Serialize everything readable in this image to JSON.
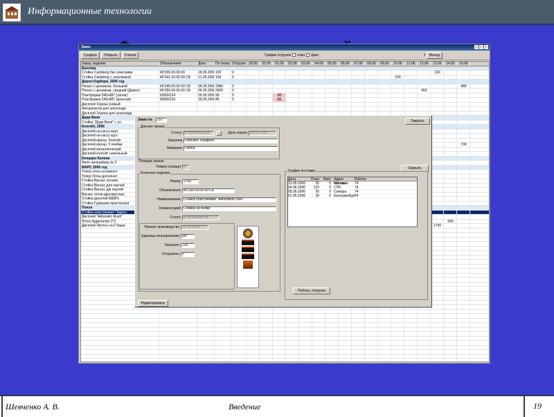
{
  "header": {
    "title": "Информационные технологии"
  },
  "slide": {
    "title": "Формирование производственной программы"
  },
  "footer": {
    "author": "Шевченко А. В.",
    "section": "Введение",
    "page": "19"
  },
  "app": {
    "window_title": "Заказ",
    "toolbar": {
      "create": "Создать",
      "open": "Открыть",
      "list": "Список",
      "chart_label": "График отгрузок",
      "plan_label": "план",
      "fact_label": "факт",
      "info": "i",
      "exit": "Выход"
    },
    "columns": [
      "Заказ, изделие",
      "Обозначение",
      "Дата",
      "По плану",
      "Отгрузка",
      "30.05",
      "31.05",
      "01.06",
      "02.06",
      "03.06",
      "04.06",
      "05.06",
      "06.06",
      "07.06",
      "08.06",
      "09.06",
      "10.06",
      "11.06",
      "12.06",
      "13.06",
      "14.06",
      "15.06"
    ],
    "rows": [
      {
        "g": true,
        "n": "Балтика"
      },
      {
        "n": "Стойка Carlsberg без электрики",
        "o": "КР.339.00.00.00",
        "d": "18.05.2006",
        "p": "100",
        "s": "0",
        "m": [
          14,
          "100"
        ]
      },
      {
        "n": "Стойка Carlsberg с электрикой",
        "o": "КР.341.00.00.00 СБ",
        "d": "21.05.2006",
        "p": "100",
        "s": "0",
        "m": [
          11,
          "100"
        ]
      },
      {
        "g": true,
        "n": "Дирол Кэдбери, 2006 год"
      },
      {
        "n": "Пенал с ценником, большой",
        "o": "КР.349.00.00.00 СБ",
        "d": "06.05.2006",
        "p": "2980",
        "s": "0",
        "m": [
          16,
          "480"
        ]
      },
      {
        "n": "Пенал с ценником, средний (Дирол)",
        "o": "КР.350.00.00.00 СБ",
        "d": "06.05.2006",
        "p": "2950",
        "s": "0",
        "m": [
          13,
          "450"
        ]
      },
      {
        "n": "Платформа 540х487 (синяя)",
        "o": "60006224",
        "d": "30.05.2006",
        "p": "90",
        "s": "0",
        "h": 2,
        "m": [
          2,
          "90"
        ]
      },
      {
        "n": "Платформа 540х487 (красная)",
        "o": "60006226",
        "d": "30.05.2006",
        "p": "86",
        "s": "0",
        "h": 2,
        "m": [
          2,
          "86"
        ]
      },
      {
        "n": "Дисплей Хорека (новый",
        "o": "",
        "d": "",
        "p": "",
        "s": ""
      },
      {
        "n": "Авторизатор для шоколада",
        "o": "",
        "d": "",
        "p": "",
        "s": ""
      },
      {
        "n": "Дисплей Хорека для шоколада",
        "o": "",
        "d": "",
        "p": "",
        "s": ""
      },
      {
        "g": true,
        "n": "Дядя Ваня"
      },
      {
        "n": "Стойка \"Дядя Ваня\" с эл.",
        "o": "",
        "d": "",
        "p": "",
        "s": ""
      },
      {
        "g": true,
        "n": "Колгейт, 2006"
      },
      {
        "n": "Дисплей на кассу верт.",
        "o": "",
        "d": "",
        "p": "",
        "s": ""
      },
      {
        "n": "Дисплей на кассу круг.",
        "o": "",
        "d": "",
        "p": "",
        "s": ""
      },
      {
        "n": "Дисплей-кронш. Колгейт",
        "o": "",
        "d": "",
        "p": "",
        "s": ""
      },
      {
        "n": "Дисплей кронш. 3 ячейки",
        "o": "",
        "d": "",
        "p": "",
        "s": "",
        "m": [
          16,
          "700"
        ]
      },
      {
        "n": "Дисплей металлический",
        "o": "",
        "d": "",
        "p": "",
        "s": ""
      },
      {
        "n": "Дисплей колгейт напольный",
        "o": "",
        "d": "",
        "p": "",
        "s": ""
      },
      {
        "g": true,
        "n": "Концерн Калина"
      },
      {
        "n": "Фиче органайзер № 2",
        "o": "",
        "d": "",
        "p": "",
        "s": ""
      },
      {
        "g": true,
        "n": "МАРС 2006 год"
      },
      {
        "n": "Топер orrea основного",
        "o": "",
        "d": "",
        "p": "",
        "s": ""
      },
      {
        "n": "Топер Оrrea дополнит.",
        "o": "",
        "d": "",
        "p": "",
        "s": ""
      },
      {
        "n": "Стойка Вискас полная",
        "o": "",
        "d": "",
        "p": "",
        "s": ""
      },
      {
        "n": "Стойка Вискас для паучей",
        "o": "",
        "d": "",
        "p": "",
        "s": ""
      },
      {
        "n": "Стойка Вискас д/в паучей",
        "o": "",
        "d": "",
        "p": "",
        "s": ""
      },
      {
        "n": "Вискас лотки двухярусные",
        "o": "",
        "d": "",
        "p": "",
        "s": ""
      },
      {
        "n": "Стойка-дисплей M&M's",
        "o": "",
        "d": "",
        "p": "",
        "s": ""
      },
      {
        "n": "Стойка Гурмания пристенная",
        "o": "",
        "d": "",
        "p": "",
        "s": ""
      },
      {
        "g": true,
        "n": "Пепси"
      },
      {
        "n": "Стойка пластиковая \"Адрен.",
        "o": "",
        "d": "",
        "p": "",
        "s": "",
        "sel": true
      },
      {
        "n": "Дисплей \"Adrenalin Rush\"",
        "o": "",
        "d": "",
        "p": "",
        "s": ""
      },
      {
        "n": "Лоток Адреналин 3*2",
        "o": "",
        "d": "",
        "p": "",
        "s": "",
        "m": [
          15,
          "600"
        ]
      },
      {
        "n": "Дисплей Липтон на 6 башн.",
        "o": "",
        "d": "",
        "p": "",
        "s": "",
        "m": [
          14,
          "1700"
        ]
      }
    ],
    "dialog": {
      "order_label": "Заказ №",
      "order_no": "157",
      "close": "Закрыть",
      "data_title": "Данные заказа",
      "status_label": "Статус",
      "status_val": "В производстве",
      "date_label": "Дата заказа",
      "date_val": "14.04.2006",
      "customer_label": "Заказчик",
      "customer_val": "ПепсиКо Холдингс",
      "name_label": "Название",
      "name_val": "Пепси",
      "pos_title": "Позиции заказа",
      "pos_no_label": "Номер позиции",
      "pos_no_val": "1",
      "close2": "Закрыть",
      "final_title": "Конечное изделие",
      "num_label": "Номер",
      "num_val": "2765",
      "desig_label": "Обозначение",
      "desig_val": "КР.136.00.00.00 СБ",
      "naming_label": "Наименование",
      "naming_val": "Стойка пластиковая \"Adrenaline rush\"",
      "comment_label": "Комментарий",
      "comment_val": "Стикер на полки",
      "status2_label": "Статус",
      "status2_val": "В производстве",
      "start_label": "Начало производства",
      "start_val": "14.04.2006",
      "unit_label": "Единица планирования",
      "unit_val": "шт.",
      "ordered_label": "Заказано",
      "ordered_val": "225",
      "shipped_label": "Отгружено",
      "shipped_val": "0",
      "ship_title": "График поставки",
      "ship_cols": [
        "Дата",
        "План",
        "Факт",
        "Адрес поставки",
        "Работа"
      ],
      "ship_rows": [
        [
          "31.05.2006",
          "20",
          "0",
          "Москва",
          "74"
        ],
        [
          "04.06.2006",
          "120",
          "0",
          "СПб",
          "74"
        ],
        [
          "05.06.2006",
          "55",
          "0",
          "Самара",
          "74"
        ],
        [
          "01.06.2006",
          "30",
          "0",
          "Екатеринбург",
          "74"
        ]
      ],
      "works_btn": "Работы, отгрузка",
      "edit_btn": "Редактировать"
    }
  }
}
